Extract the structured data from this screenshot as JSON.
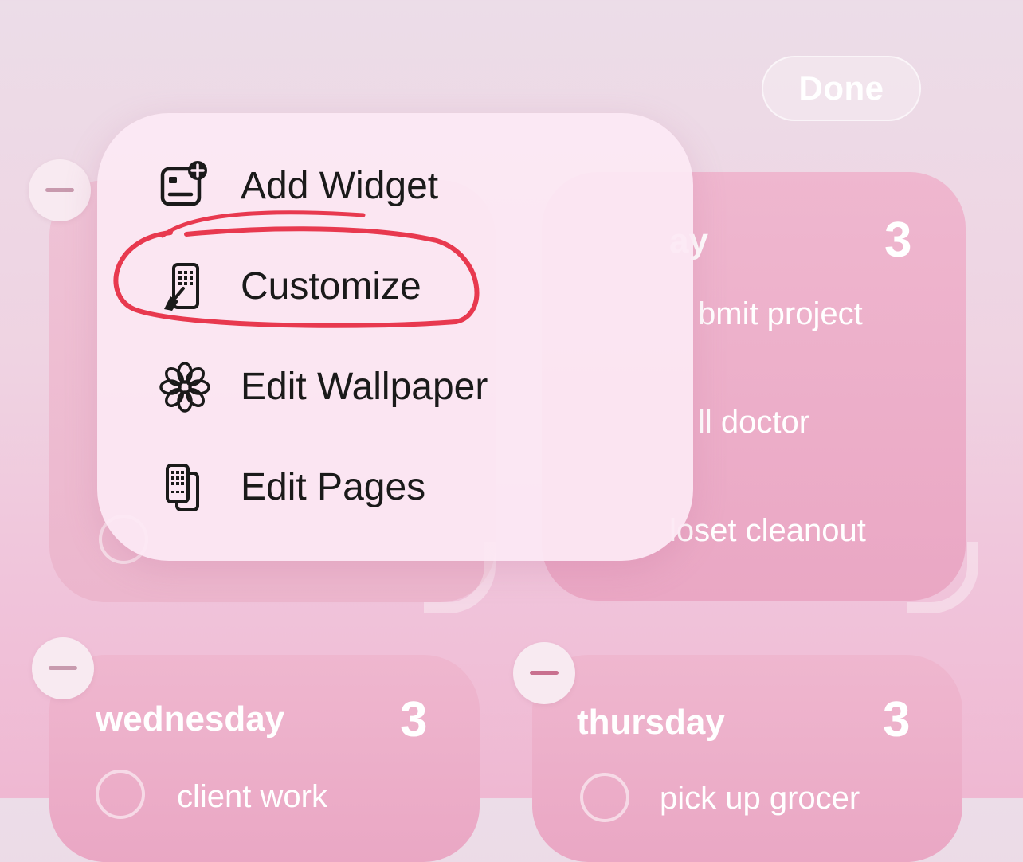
{
  "toolbar": {
    "done_label": "Done"
  },
  "menu": {
    "items": [
      {
        "label": "Add Widget",
        "icon": "add-widget-icon"
      },
      {
        "label": "Customize",
        "icon": "customize-icon"
      },
      {
        "label": "Edit Wallpaper",
        "icon": "flower-icon"
      },
      {
        "label": "Edit Pages",
        "icon": "pages-icon"
      }
    ]
  },
  "widgets": {
    "top_right": {
      "title": "ay",
      "count": "3",
      "items": [
        "bmit project",
        "ll doctor",
        "loset cleanout"
      ]
    },
    "wednesday": {
      "title": "wednesday",
      "count": "3",
      "items": [
        "client work"
      ]
    },
    "thursday": {
      "title": "thursday",
      "count": "3",
      "items": [
        "pick up grocer"
      ]
    }
  },
  "colors": {
    "annotation": "#e8394f",
    "widget_pink": "#eaa7c4",
    "menu_bg": "#fce8f4"
  }
}
